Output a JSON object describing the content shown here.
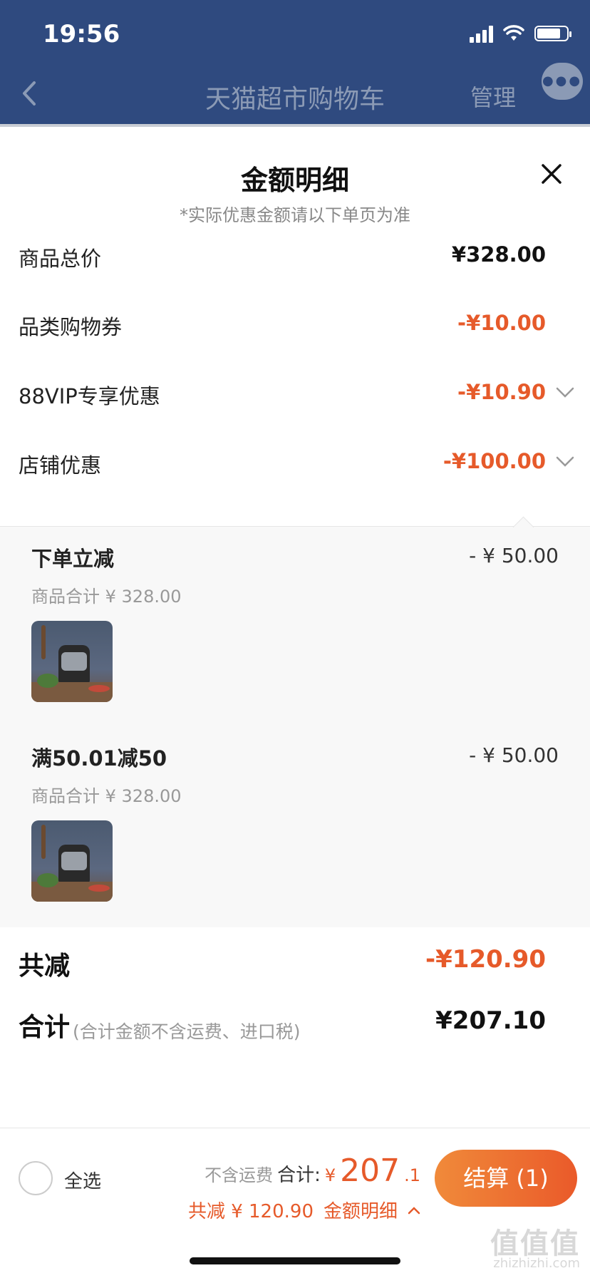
{
  "status_bar": {
    "time": "19:56"
  },
  "nav": {
    "title": "天猫超市购物车",
    "manage": "管理"
  },
  "sheet": {
    "title": "金额明细",
    "subtitle": "*实际优惠金额请以下单页为准",
    "rows": [
      {
        "label": "商品总价",
        "value": "¥328.00"
      },
      {
        "label": "品类购物券",
        "value": "-¥10.00"
      },
      {
        "label": "88VIP专享优惠",
        "value": "-¥10.90"
      },
      {
        "label": "店铺优惠",
        "value": "-¥100.00"
      }
    ],
    "shop_details": [
      {
        "title": "下单立减",
        "amount": "- ¥ 50.00",
        "subtotal": "商品合计 ¥ 328.00"
      },
      {
        "title": "满50.01减50",
        "amount": "- ¥ 50.00",
        "subtotal": "商品合计 ¥ 328.00"
      }
    ],
    "total_discount": {
      "label": "共减",
      "value": "-¥120.90"
    },
    "total": {
      "label": "合计",
      "note": "(合计金额不含运费、进口税)",
      "value": "¥207.10"
    }
  },
  "bottom": {
    "select_all": "全选",
    "no_shipping": "不含运费",
    "total_label": "合计:",
    "currency": "¥",
    "total_int": "207",
    "total_dec": ".1",
    "discount_text": "共减 ¥ 120.90",
    "detail_link": "金额明细",
    "checkout": "结算 (1)"
  },
  "watermark": {
    "main": "值值值",
    "sub": "zhizhizhi.com"
  },
  "colors": {
    "nav_bg": "#2f4a7f",
    "accent": "#e65a2a"
  }
}
